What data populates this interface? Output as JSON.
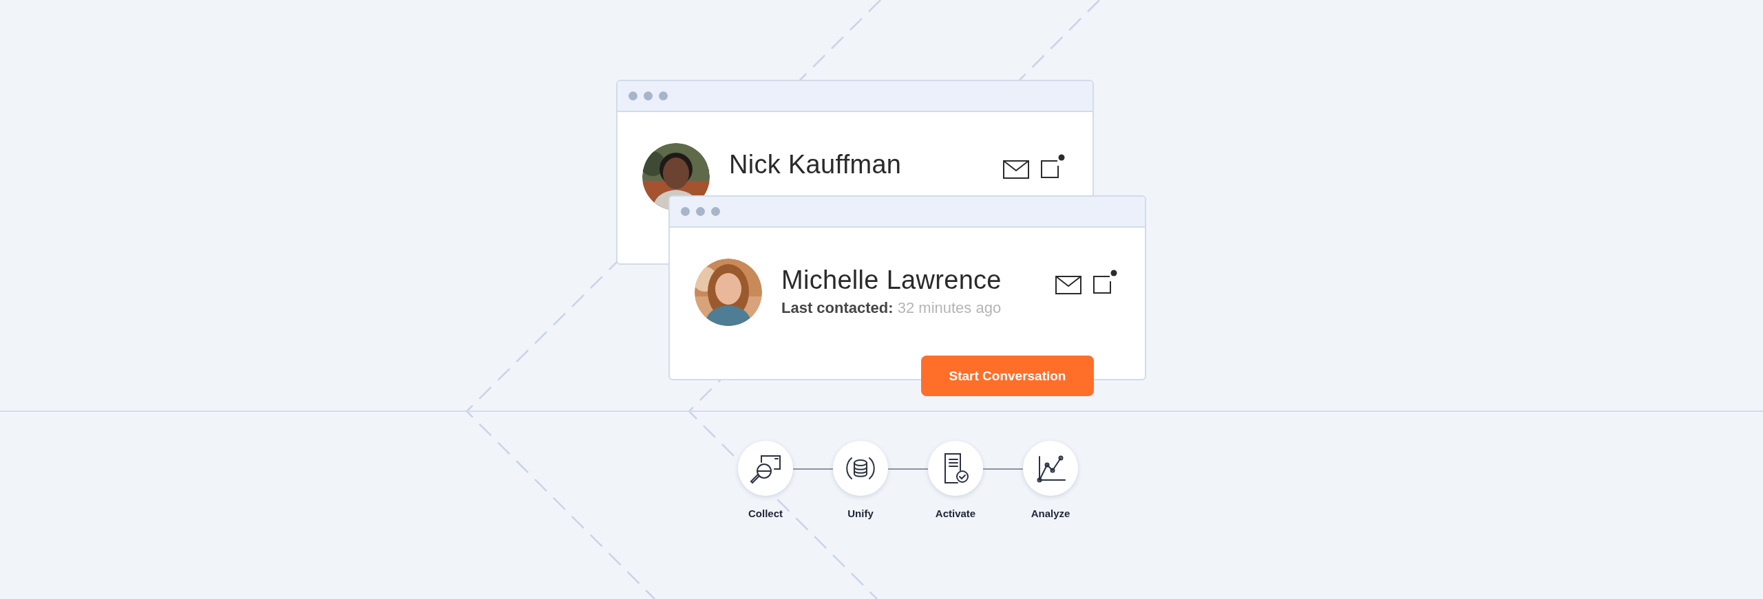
{
  "windows": [
    {
      "name": "Nick Kauffman"
    },
    {
      "name": "Michelle Lawrence",
      "last_contacted_label": "Last contacted:",
      "last_contacted_value": "32 minutes ago",
      "button": "Start Conversation"
    }
  ],
  "steps": [
    {
      "label": "Collect",
      "kind": "collect"
    },
    {
      "label": "Unify",
      "kind": "unify"
    },
    {
      "label": "Activate",
      "kind": "activate"
    },
    {
      "label": "Analyze",
      "kind": "analyze"
    }
  ]
}
